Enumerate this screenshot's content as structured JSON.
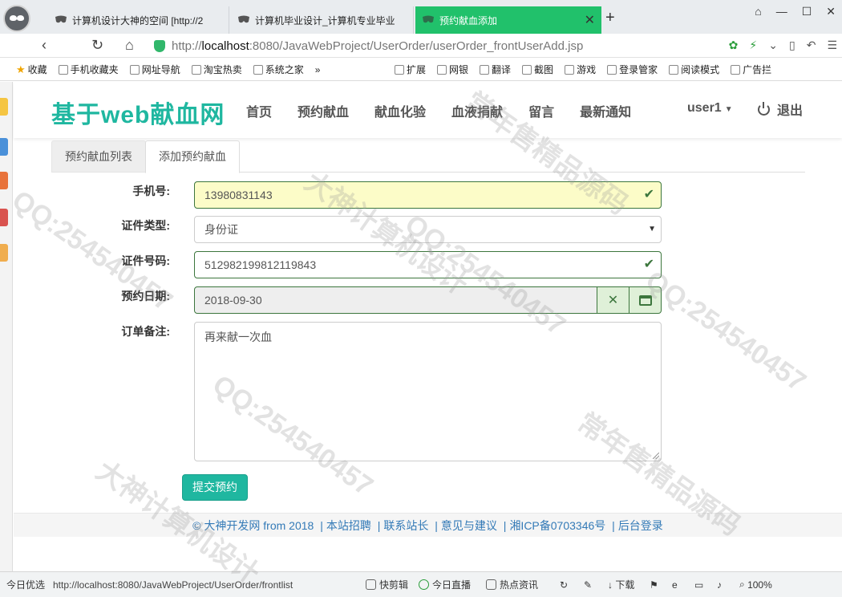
{
  "browser": {
    "tabs": [
      {
        "label": "计算机设计大神的空间 [http://2",
        "active": false
      },
      {
        "label": "计算机毕业设计_计算机专业毕业",
        "active": false
      },
      {
        "label": "预约献血添加",
        "active": true
      }
    ],
    "url_host": "localhost",
    "url_prefix": "http://",
    "url_rest": ":8080/JavaWebProject/UserOrder/userOrder_frontUserAdd.jsp",
    "bookmarks_left": [
      "收藏",
      "手机收藏夹",
      "网址导航",
      "淘宝热卖",
      "系统之家"
    ],
    "bookmarks_right": [
      "扩展",
      "网银",
      "翻译",
      "截图",
      "游戏",
      "登录管家",
      "阅读模式",
      "广告拦"
    ]
  },
  "site": {
    "brand": "基于web献血网",
    "nav": [
      "首页",
      "预约献血",
      "献血化验",
      "血液捐献",
      "留言",
      "最新通知"
    ],
    "user": "user1",
    "logout": "退出"
  },
  "tabs": {
    "list": "预约献血列表",
    "add": "添加预约献血"
  },
  "form": {
    "phone_label": "手机号:",
    "phone_value": "13980831143",
    "idtype_label": "证件类型:",
    "idtype_value": "身份证",
    "idno_label": "证件号码:",
    "idno_value": "512982199812119843",
    "date_label": "预约日期:",
    "date_value": "2018-09-30",
    "note_label": "订单备注:",
    "note_value": "再来献一次血",
    "submit_label": "提交预约"
  },
  "footer": {
    "copyright": "© 大神开发网 from 2018",
    "links": [
      "本站招聘",
      "联系站长",
      "意见与建议",
      "湘ICP备0703346号",
      "后台登录"
    ]
  },
  "statusbar": {
    "left": "今日优选",
    "link": "http://localhost:8080/JavaWebProject/UserOrder/frontlist",
    "items": [
      "快剪辑",
      "今日直播",
      "热点资讯"
    ],
    "download": "下载",
    "zoom": "100%"
  },
  "watermarks": [
    "QQ:254540457",
    "大神计算机设计",
    "常年售精品源码"
  ],
  "colors": {
    "brand": "#1fb7a0",
    "valid": "#3c763d",
    "active_tab": "#21c16b",
    "link": "#337ab7"
  }
}
